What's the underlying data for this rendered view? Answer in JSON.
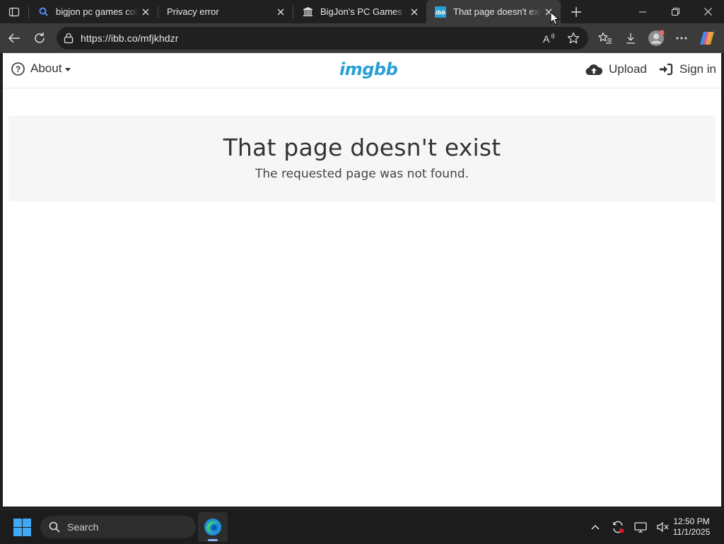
{
  "browser": {
    "tabs": [
      {
        "title": "bigjon pc games collecti",
        "icon": "search-icon"
      },
      {
        "title": "Privacy error",
        "icon": "none"
      },
      {
        "title": "BigJon's PC Games Colle",
        "icon": "archive-icon"
      },
      {
        "title": "That page doesn't exist",
        "icon": "imgbb-favicon",
        "active": true
      }
    ],
    "url": "https://ibb.co/mfjkhdzr"
  },
  "site": {
    "about_label": "About",
    "logo_text": "imgbb",
    "upload_label": "Upload",
    "signin_label": "Sign in",
    "brand_color": "#2a9fd6"
  },
  "error": {
    "heading": "That page doesn't exist",
    "message": "The requested page was not found."
  },
  "taskbar": {
    "search_label": "Search",
    "time": "12:50 PM",
    "date": "11/1/2025"
  }
}
